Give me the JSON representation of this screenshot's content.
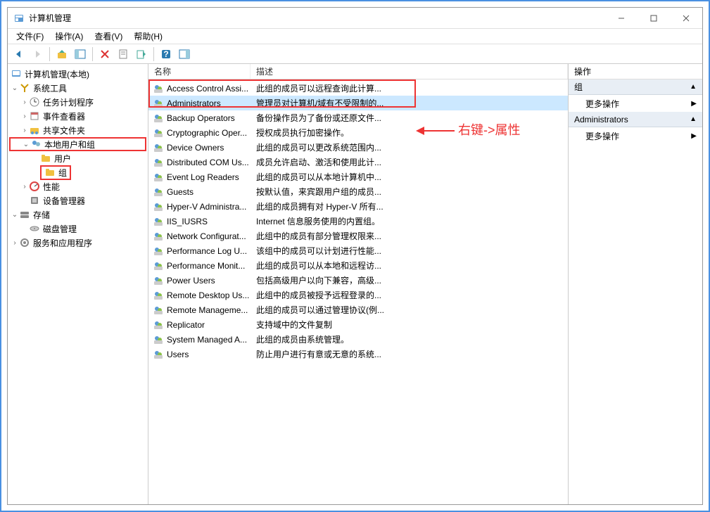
{
  "window": {
    "title": "计算机管理"
  },
  "menu": {
    "file": "文件(F)",
    "action": "操作(A)",
    "view": "查看(V)",
    "help": "帮助(H)"
  },
  "tree": {
    "root": "计算机管理(本地)",
    "system_tools": "系统工具",
    "task_scheduler": "任务计划程序",
    "event_viewer": "事件查看器",
    "shared_folders": "共享文件夹",
    "local_users_groups": "本地用户和组",
    "users": "用户",
    "groups": "组",
    "performance": "性能",
    "device_manager": "设备管理器",
    "storage": "存储",
    "disk_management": "磁盘管理",
    "services_apps": "服务和应用程序"
  },
  "list": {
    "header_name": "名称",
    "header_desc": "描述",
    "rows": [
      {
        "name": "Access Control Assi...",
        "desc": "此组的成员可以远程查询此计算..."
      },
      {
        "name": "Administrators",
        "desc": "管理员对计算机/域有不受限制的..."
      },
      {
        "name": "Backup Operators",
        "desc": "备份操作员为了备份或还原文件..."
      },
      {
        "name": "Cryptographic Oper...",
        "desc": "授权成员执行加密操作。"
      },
      {
        "name": "Device Owners",
        "desc": "此组的成员可以更改系统范围内..."
      },
      {
        "name": "Distributed COM Us...",
        "desc": "成员允许启动、激活和使用此计..."
      },
      {
        "name": "Event Log Readers",
        "desc": "此组的成员可以从本地计算机中..."
      },
      {
        "name": "Guests",
        "desc": "按默认值，来宾跟用户组的成员..."
      },
      {
        "name": "Hyper-V Administra...",
        "desc": "此组的成员拥有对 Hyper-V 所有..."
      },
      {
        "name": "IIS_IUSRS",
        "desc": "Internet 信息服务使用的内置组。"
      },
      {
        "name": "Network Configurat...",
        "desc": "此组中的成员有部分管理权限来..."
      },
      {
        "name": "Performance Log U...",
        "desc": "该组中的成员可以计划进行性能..."
      },
      {
        "name": "Performance Monit...",
        "desc": "此组的成员可以从本地和远程访..."
      },
      {
        "name": "Power Users",
        "desc": "包括高级用户以向下兼容，高级..."
      },
      {
        "name": "Remote Desktop Us...",
        "desc": "此组中的成员被授予远程登录的..."
      },
      {
        "name": "Remote Manageme...",
        "desc": "此组的成员可以通过管理协议(例..."
      },
      {
        "name": "Replicator",
        "desc": "支持域中的文件复制"
      },
      {
        "name": "System Managed A...",
        "desc": "此组的成员由系统管理。"
      },
      {
        "name": "Users",
        "desc": "防止用户进行有意或无意的系统..."
      }
    ]
  },
  "actions": {
    "header": "操作",
    "section1": "组",
    "more1": "更多操作",
    "section2": "Administrators",
    "more2": "更多操作"
  },
  "annotation": {
    "text": "右键->属性"
  }
}
